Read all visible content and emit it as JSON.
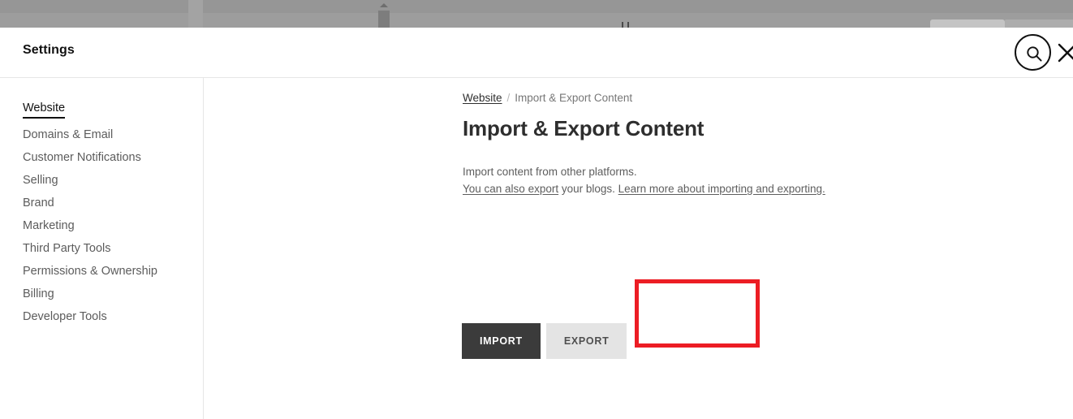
{
  "backdrop": {
    "note": "dimmed underlying page strip"
  },
  "header": {
    "title": "Settings",
    "search_icon": "search-icon",
    "close_icon": "close-icon"
  },
  "sidebar": {
    "items": [
      {
        "label": "Website",
        "active": true
      },
      {
        "label": "Domains & Email",
        "active": false
      },
      {
        "label": "Customer Notifications",
        "active": false
      },
      {
        "label": "Selling",
        "active": false
      },
      {
        "label": "Brand",
        "active": false
      },
      {
        "label": "Marketing",
        "active": false
      },
      {
        "label": "Third Party Tools",
        "active": false
      },
      {
        "label": "Permissions & Ownership",
        "active": false
      },
      {
        "label": "Billing",
        "active": false
      },
      {
        "label": "Developer Tools",
        "active": false
      }
    ]
  },
  "main": {
    "breadcrumb": {
      "parent": "Website",
      "separator": "/",
      "current": "Import & Export Content"
    },
    "heading": "Import & Export Content",
    "description": {
      "line1": "Import content from other platforms.",
      "line2_link1": "You can also export",
      "line2_mid": " your blogs. ",
      "line2_link2": "Learn more about importing and exporting."
    },
    "buttons": {
      "import_label": "IMPORT",
      "export_label": "EXPORT"
    }
  },
  "annotation": {
    "color": "#ec1d24",
    "target": "import-export-buttons"
  },
  "colors": {
    "import_button_bg": "#3b3b3b",
    "export_button_bg": "#e4e4e4",
    "annotation_red": "#ec1d24",
    "text_primary": "#2e2e2e",
    "text_muted": "#5e5e5e",
    "divider": "#e6e6e6"
  }
}
